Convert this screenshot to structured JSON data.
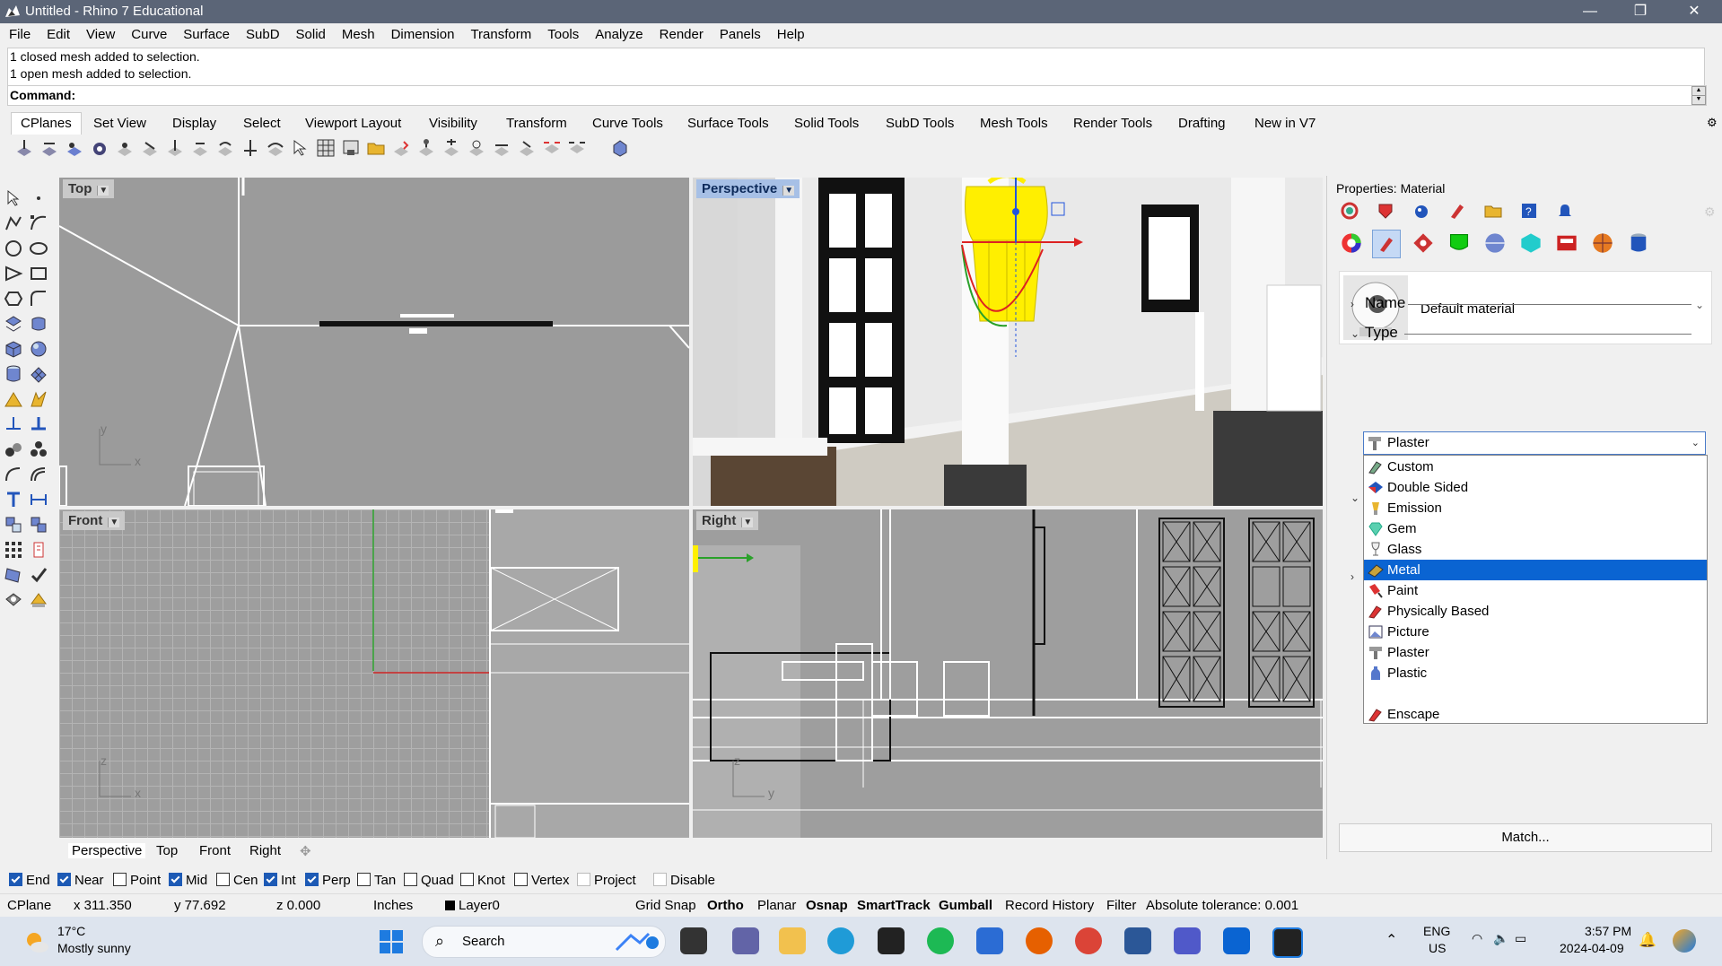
{
  "window": {
    "title": "Untitled - Rhino 7 Educational",
    "minimize": "—",
    "restore": "❐",
    "close": "✕"
  },
  "menu": [
    "File",
    "Edit",
    "View",
    "Curve",
    "Surface",
    "SubD",
    "Solid",
    "Mesh",
    "Dimension",
    "Transform",
    "Tools",
    "Analyze",
    "Render",
    "Panels",
    "Help"
  ],
  "history": [
    "1 closed mesh added to selection.",
    "1 open mesh added to selection."
  ],
  "command_label": "Command:",
  "toolbar_tabs": [
    "CPlanes",
    "Set View",
    "Display",
    "Select",
    "Viewport Layout",
    "Visibility",
    "Transform",
    "Curve Tools",
    "Surface Tools",
    "Solid Tools",
    "SubD Tools",
    "Mesh Tools",
    "Render Tools",
    "Drafting",
    "New in V7"
  ],
  "viewports": {
    "top": "Top",
    "perspective": "Perspective",
    "front": "Front",
    "right": "Right"
  },
  "viewport_tabs": [
    "Perspective",
    "Top",
    "Front",
    "Right"
  ],
  "axes": {
    "x": "x",
    "y": "y",
    "z": "z"
  },
  "properties": {
    "title": "Properties: Material",
    "material_name": "Default material",
    "sections": {
      "name": "Name",
      "type": "Type"
    },
    "type_selected": "Plaster",
    "type_options": [
      "Custom",
      "Double Sided",
      "Emission",
      "Gem",
      "Glass",
      "Metal",
      "Paint",
      "Physically Based",
      "Picture",
      "Plaster",
      "Plastic",
      "",
      "Enscape"
    ],
    "highlighted_option": "Metal",
    "match_button": "Match..."
  },
  "osnap": [
    {
      "label": "End",
      "checked": true
    },
    {
      "label": "Near",
      "checked": true
    },
    {
      "label": "Point",
      "checked": false
    },
    {
      "label": "Mid",
      "checked": true
    },
    {
      "label": "Cen",
      "checked": false
    },
    {
      "label": "Int",
      "checked": true
    },
    {
      "label": "Perp",
      "checked": true
    },
    {
      "label": "Tan",
      "checked": false
    },
    {
      "label": "Quad",
      "checked": false
    },
    {
      "label": "Knot",
      "checked": false
    },
    {
      "label": "Vertex",
      "checked": false
    },
    {
      "label": "Project",
      "checked": false
    },
    {
      "label": "Disable",
      "checked": false
    }
  ],
  "status": {
    "cplane": "CPlane",
    "x": "x 311.350",
    "y": "y 77.692",
    "z": "z 0.000",
    "units": "Inches",
    "layer": "Layer0",
    "grid_snap": "Grid Snap",
    "ortho": "Ortho",
    "planar": "Planar",
    "osnap": "Osnap",
    "smarttrack": "SmartTrack",
    "gumball": "Gumball",
    "record_history": "Record History",
    "filter": "Filter",
    "tolerance": "Absolute tolerance: 0.001"
  },
  "taskbar": {
    "weather_temp": "17°C",
    "weather_desc": "Mostly sunny",
    "search": "Search",
    "lang1": "ENG",
    "lang2": "US",
    "time": "3:57 PM",
    "date": "2024-04-09"
  },
  "colors": {
    "titlebar": "#5b6577",
    "selection": "#0a64d2",
    "accent": "#1d5ab5"
  }
}
